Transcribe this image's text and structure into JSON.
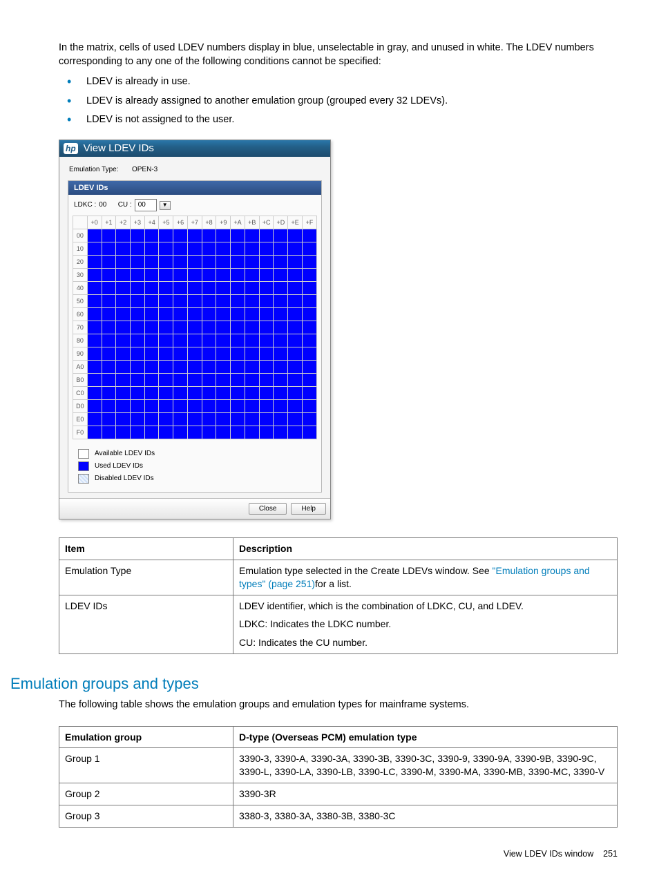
{
  "intro_text": "In the matrix, cells of used LDEV numbers display in blue, unselectable in gray, and unused in white. The LDEV numbers corresponding to any one of the following conditions cannot be specified:",
  "bullets": [
    "LDEV is already in use.",
    "LDEV is already assigned to another emulation group (grouped every 32 LDEVs).",
    "LDEV is not assigned to the user."
  ],
  "dialog": {
    "title": "View LDEV IDs",
    "emulation_label": "Emulation Type:",
    "emulation_value": "OPEN-3",
    "section_title": "LDEV IDs",
    "ldkc_label": "LDKC :",
    "ldkc_value": "00",
    "cu_label": "CU :",
    "cu_value": "00",
    "col_headers": [
      "+0",
      "+1",
      "+2",
      "+3",
      "+4",
      "+5",
      "+6",
      "+7",
      "+8",
      "+9",
      "+A",
      "+B",
      "+C",
      "+D",
      "+E",
      "+F"
    ],
    "row_headers": [
      "00",
      "10",
      "20",
      "30",
      "40",
      "50",
      "60",
      "70",
      "80",
      "90",
      "A0",
      "B0",
      "C0",
      "D0",
      "E0",
      "F0"
    ],
    "legend": {
      "available": "Available LDEV IDs",
      "used": "Used LDEV IDs",
      "disabled": "Disabled LDEV IDs"
    },
    "buttons": {
      "close": "Close",
      "help": "Help"
    }
  },
  "table1": {
    "head": {
      "item": "Item",
      "desc": "Description"
    },
    "rows": [
      {
        "item": "Emulation Type",
        "desc_pre": "Emulation type selected in the Create LDEVs window. See ",
        "desc_link": "\"Emulation groups and types\" (page 251)",
        "desc_post": "for a list."
      },
      {
        "item": "LDEV IDs",
        "desc_line1": "LDEV identifier, which is the combination of LDKC, CU, and LDEV.",
        "desc_line2": "LDKC: Indicates the LDKC number.",
        "desc_line3": "CU: Indicates the CU number."
      }
    ]
  },
  "section_heading": "Emulation groups and types",
  "section_sub": "The following table shows the emulation groups and emulation types for mainframe systems.",
  "table2": {
    "head": {
      "group": "Emulation group",
      "type": "D-type (Overseas PCM) emulation type"
    },
    "rows": [
      {
        "group": "Group 1",
        "type": "3390-3, 3390-A, 3390-3A, 3390-3B, 3390-3C, 3390-9, 3390-9A, 3390-9B, 3390-9C, 3390-L, 3390-LA, 3390-LB, 3390-LC, 3390-M, 3390-MA, 3390-MB, 3390-MC, 3390-V"
      },
      {
        "group": "Group 2",
        "type": "3390-3R"
      },
      {
        "group": "Group 3",
        "type": "3380-3, 3380-3A, 3380-3B, 3380-3C"
      }
    ]
  },
  "footer": {
    "text": "View LDEV IDs window",
    "page": "251"
  }
}
